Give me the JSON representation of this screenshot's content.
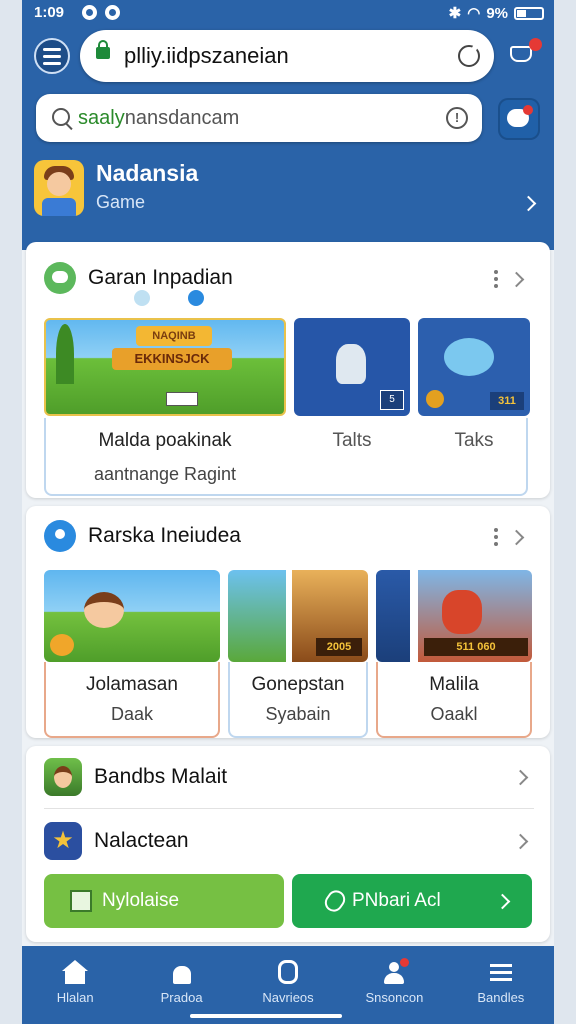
{
  "status": {
    "time": "1:09",
    "battery": "9%"
  },
  "browser": {
    "url": "plliy.iidpszaneian"
  },
  "search": {
    "prefix": "saaly",
    "rest": "nansdancam"
  },
  "app": {
    "name": "Nadansia",
    "subtitle": "Game"
  },
  "section1": {
    "title": "Garan Inpadian",
    "banner_title": "NAQINB",
    "banner_sub": "EKKINSJCK",
    "tiles": [
      {
        "label": "Malda poakinak",
        "sub": "aantnange Ragint"
      },
      {
        "label": "Talts",
        "badge": "5"
      },
      {
        "label": "Taks",
        "badge": "311"
      }
    ]
  },
  "section2": {
    "title": "Rarska Ineiudea",
    "tiles": [
      {
        "label": "Jolamasan",
        "sub": "Daak"
      },
      {
        "label": "Gonepstan",
        "sub": "Syabain",
        "badge": "2005"
      },
      {
        "label": "Malila",
        "sub": "Oaakl",
        "badge": "511 060"
      }
    ]
  },
  "section3": {
    "rows": [
      {
        "label": "Bandbs Malait"
      },
      {
        "label": "Nalactean"
      }
    ],
    "buttons": [
      {
        "label": "Nylolaise"
      },
      {
        "label": "PNbari Acl"
      }
    ]
  },
  "nav": [
    {
      "label": "Hlalan",
      "icon": "home-icon"
    },
    {
      "label": "Pradoa",
      "icon": "store-icon"
    },
    {
      "label": "Navrieos",
      "icon": "shield-icon"
    },
    {
      "label": "Snsoncon",
      "icon": "profile-icon"
    },
    {
      "label": "Bandles",
      "icon": "menu-icon"
    }
  ],
  "colors": {
    "primary": "#2a63a8",
    "green": "#76c043",
    "dark_green": "#1fa84f"
  }
}
